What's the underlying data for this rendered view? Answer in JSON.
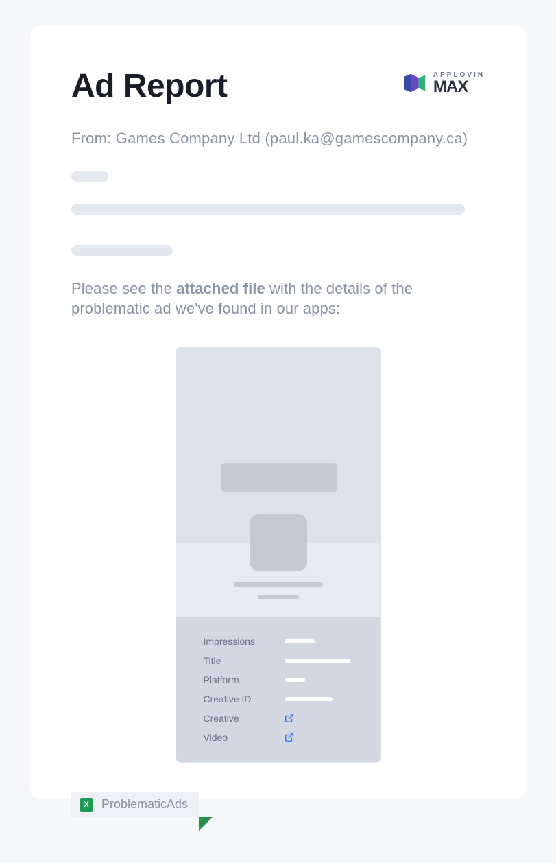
{
  "logo": {
    "brand_small": "APPLOVIN",
    "brand_big": "MAX"
  },
  "header": {
    "title": "Ad Report"
  },
  "from": {
    "prefix": "From: ",
    "company": "Games Company Ltd ",
    "email": "(paul.ka@gamescompany.ca)"
  },
  "body": {
    "pre": "Please see the ",
    "bold": "attached file",
    "post": " with the details of the problematic ad we've found in our apps:"
  },
  "details": {
    "rows": [
      {
        "label": "Impressions"
      },
      {
        "label": "Title"
      },
      {
        "label": "Platform"
      },
      {
        "label": "Creative ID"
      },
      {
        "label": "Creative"
      },
      {
        "label": "Video"
      }
    ]
  },
  "attachment": {
    "icon_letter": "X",
    "name": "ProblematicAds"
  }
}
